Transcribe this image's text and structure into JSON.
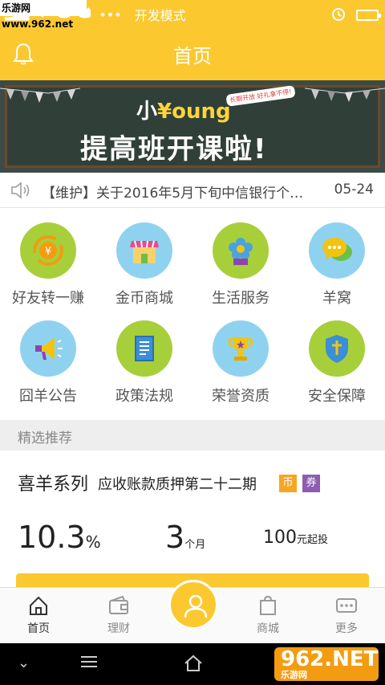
{
  "status_bar": {
    "watermark": "乐游网 www.962.net",
    "mode": "开发模式"
  },
  "header": {
    "title": "首页"
  },
  "banner": {
    "line1_prefix": "小",
    "line1_brand": "¥oung",
    "line2": "提高班开课啦!",
    "tag": "长期开放 好礼拿不停!"
  },
  "notice": {
    "text": "【维护】关于2016年5月下旬中信银行个…",
    "date": "05-24"
  },
  "grid": [
    {
      "label": "好友转一赚",
      "icon": "yen-cycle-icon",
      "color": "green"
    },
    {
      "label": "金币商城",
      "icon": "shop-icon",
      "color": "blue"
    },
    {
      "label": "生活服务",
      "icon": "flower-icon",
      "color": "green"
    },
    {
      "label": "羊窝",
      "icon": "chat-icon",
      "color": "blue"
    },
    {
      "label": "囧羊公告",
      "icon": "megaphone-icon",
      "color": "blue"
    },
    {
      "label": "政策法规",
      "icon": "book-icon",
      "color": "green"
    },
    {
      "label": "荣誉资质",
      "icon": "trophy-icon",
      "color": "blue"
    },
    {
      "label": "安全保障",
      "icon": "shield-icon",
      "color": "green"
    }
  ],
  "section": {
    "title": "精选推荐"
  },
  "product": {
    "name": "喜羊系列",
    "subtitle": "应收账款质押第二十二期",
    "badge_coin": "币",
    "badge_ticket": "券",
    "rate_value": "10.3",
    "rate_unit": "%",
    "term_value": "3",
    "term_unit": "个月",
    "min_value": "100",
    "min_unit": "元起投"
  },
  "tabbar": {
    "home": "首页",
    "finance": "理财",
    "mall": "商城",
    "more": "更多"
  },
  "watermark_bottom": {
    "main": "962.NET",
    "sub": "乐游网"
  },
  "colors": {
    "brand": "#fbc92f",
    "green": "#a7cf3a",
    "blue": "#8fd2f0"
  }
}
